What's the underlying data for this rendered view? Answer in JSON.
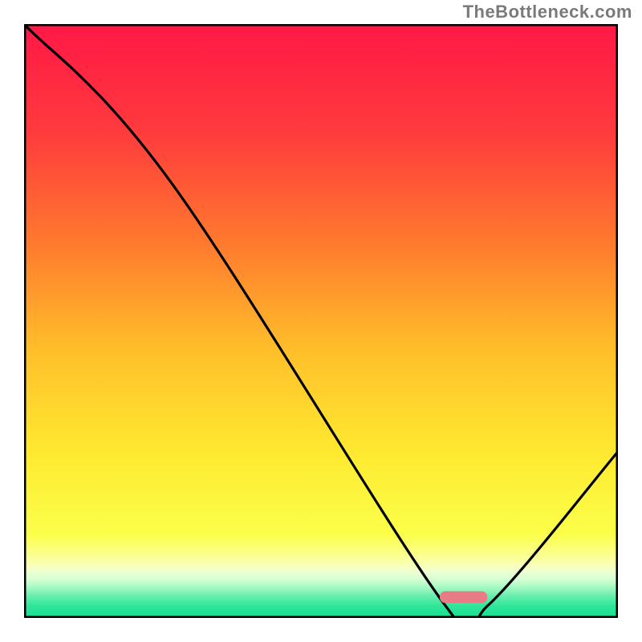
{
  "watermark": "TheBottleneck.com",
  "chart_data": {
    "type": "line",
    "title": "",
    "xlabel": "",
    "ylabel": "",
    "xlim": [
      0,
      100
    ],
    "ylim": [
      0,
      100
    ],
    "x": [
      0,
      25,
      71,
      78,
      100
    ],
    "y": [
      100,
      73,
      2,
      2,
      28
    ],
    "marker": {
      "x": 74,
      "y": 3.5,
      "width": 8,
      "height": 2
    },
    "gradient_stops": [
      {
        "offset": 0.0,
        "color": "#ff1846"
      },
      {
        "offset": 0.18,
        "color": "#ff3a3d"
      },
      {
        "offset": 0.37,
        "color": "#ff7a2e"
      },
      {
        "offset": 0.55,
        "color": "#ffbf2a"
      },
      {
        "offset": 0.72,
        "color": "#ffe930"
      },
      {
        "offset": 0.86,
        "color": "#fbff4a"
      },
      {
        "offset": 0.905,
        "color": "#fbffa6"
      },
      {
        "offset": 0.92,
        "color": "#f1ffd0"
      },
      {
        "offset": 0.935,
        "color": "#d6ffd4"
      },
      {
        "offset": 0.95,
        "color": "#a0f8c0"
      },
      {
        "offset": 0.965,
        "color": "#60edab"
      },
      {
        "offset": 0.98,
        "color": "#30e59a"
      },
      {
        "offset": 1.0,
        "color": "#18df90"
      }
    ],
    "frame_color": "#000000",
    "curve_color": "#000000",
    "marker_color": "#e77b86"
  }
}
